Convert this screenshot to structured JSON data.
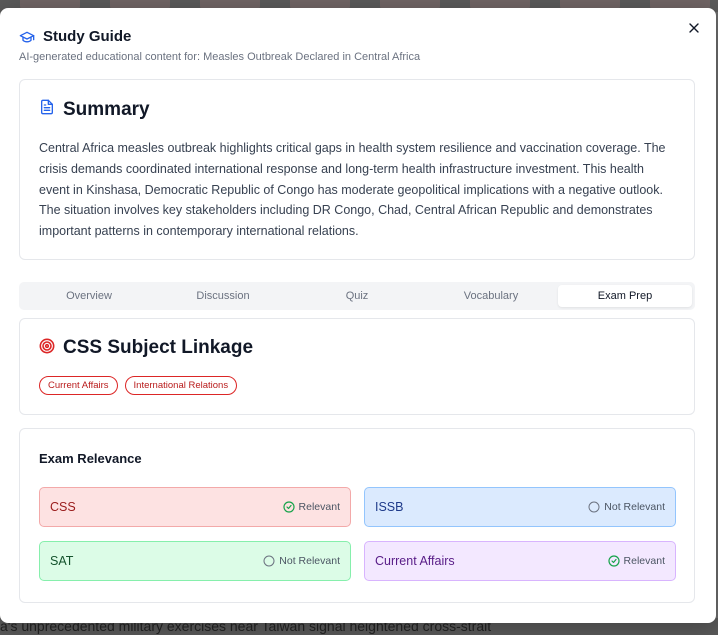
{
  "modal": {
    "title": "Study Guide",
    "subtitle": "AI-generated educational content for: Measles Outbreak Declared in Central Africa",
    "close_label": "×"
  },
  "summary": {
    "heading": "Summary",
    "text": "Central Africa measles outbreak highlights critical gaps in health system resilience and vaccination coverage. The crisis demands coordinated international response and long-term health infrastructure investment. This health event in Kinshasa, Democratic Republic of Congo has moderate geopolitical implications with a negative outlook. The situation involves key stakeholders including DR Congo, Chad, Central African Republic and demonstrates important patterns in contemporary international relations."
  },
  "tabs": [
    {
      "label": "Overview",
      "active": false
    },
    {
      "label": "Discussion",
      "active": false
    },
    {
      "label": "Quiz",
      "active": false
    },
    {
      "label": "Vocabulary",
      "active": false
    },
    {
      "label": "Exam Prep",
      "active": true
    }
  ],
  "linkage": {
    "heading": "CSS Subject Linkage",
    "tags": [
      "Current Affairs",
      "International Relations"
    ]
  },
  "relevance": {
    "heading": "Exam Relevance",
    "items": [
      {
        "name": "CSS",
        "status": "Relevant",
        "relevant": true,
        "color": "red"
      },
      {
        "name": "ISSB",
        "status": "Not Relevant",
        "relevant": false,
        "color": "blue"
      },
      {
        "name": "SAT",
        "status": "Not Relevant",
        "relevant": false,
        "color": "green"
      },
      {
        "name": "Current Affairs",
        "status": "Relevant",
        "relevant": true,
        "color": "purple"
      }
    ]
  },
  "background": {
    "bottom_text": "a's unprecedented military exercises near Taiwan signal heightened cross-strait"
  },
  "colors": {
    "accent": "#2563eb",
    "tag_red": "#dc2626",
    "check_green": "#16a34a"
  }
}
